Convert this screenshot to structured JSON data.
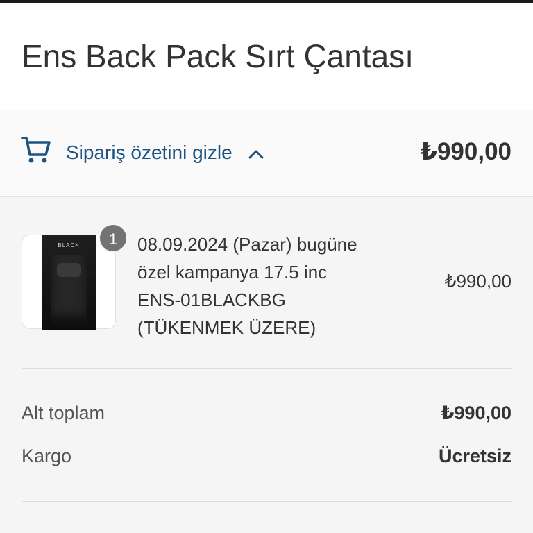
{
  "store": {
    "title": "Ens Back Pack Sırt Çantası"
  },
  "order_summary": {
    "toggle_label": "Sipariş özetini gizle",
    "total": "₺990,00",
    "cart_icon": "cart-icon",
    "chevron_icon": "chevron-up-icon"
  },
  "line_item": {
    "quantity": "1",
    "image_label": "BLACK",
    "name_lines": [
      "08.09.2024 (Pazar) bugüne",
      "özel kampanya 17.5 inc",
      "ENS-01BLACKBG",
      "(TÜKENMEK ÜZERE)"
    ],
    "price": "₺990,00"
  },
  "totals": {
    "subtotal_label": "Alt toplam",
    "subtotal_value": "₺990,00",
    "shipping_label": "Kargo",
    "shipping_value": "Ücretsiz"
  },
  "colors": {
    "accent": "#1c5380",
    "text": "#333333",
    "summary_bg": "#f5f5f5",
    "badge": "#737373"
  }
}
